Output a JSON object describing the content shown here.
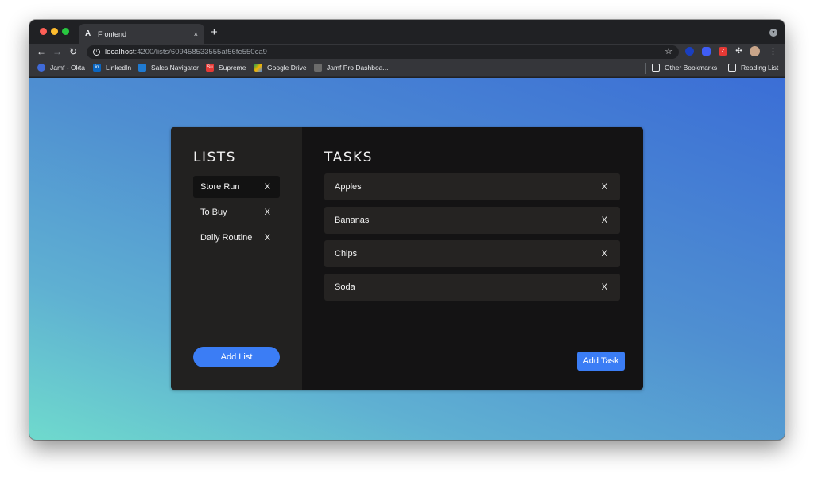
{
  "browser": {
    "tab_title": "Frontend",
    "tab_favicon": "A",
    "tab_close": "×",
    "new_tab": "+",
    "url_host": "localhost",
    "url_path": ":4200/lists/609458533555af56fe550ca9",
    "bookmarks": [
      {
        "label": "Jamf - Okta",
        "icon": "okta-icon",
        "color": "#3f6ad8"
      },
      {
        "label": "LinkedIn",
        "icon": "linkedin-icon",
        "color": "#0a66c2"
      },
      {
        "label": "Sales Navigator",
        "icon": "compass-icon",
        "color": "#1f7ad1"
      },
      {
        "label": "Supreme",
        "icon": "supreme-icon",
        "color": "#e53935"
      },
      {
        "label": "Google Drive",
        "icon": "drive-icon",
        "color": "#f4b400"
      },
      {
        "label": "Jamf Pro Dashboa...",
        "icon": "jamf-icon",
        "color": "#6b6b6b"
      }
    ],
    "other_bookmarks": "Other Bookmarks",
    "reading_list": "Reading List"
  },
  "app": {
    "lists_heading": "LISTS",
    "tasks_heading": "TASKS",
    "lists": [
      {
        "label": "Store Run",
        "close": "X",
        "active": true
      },
      {
        "label": "To Buy",
        "close": "X",
        "active": false
      },
      {
        "label": "Daily Routine",
        "close": "X",
        "active": false
      }
    ],
    "tasks": [
      {
        "label": "Apples",
        "close": "X"
      },
      {
        "label": "Bananas",
        "close": "X"
      },
      {
        "label": "Chips",
        "close": "X"
      },
      {
        "label": "Soda",
        "close": "X"
      }
    ],
    "add_list_label": "Add List",
    "add_task_label": "Add Task"
  },
  "colors": {
    "accent": "#3b7df5",
    "sidebar_bg": "#222120",
    "panel_bg": "#141314",
    "task_bg": "#252322"
  }
}
